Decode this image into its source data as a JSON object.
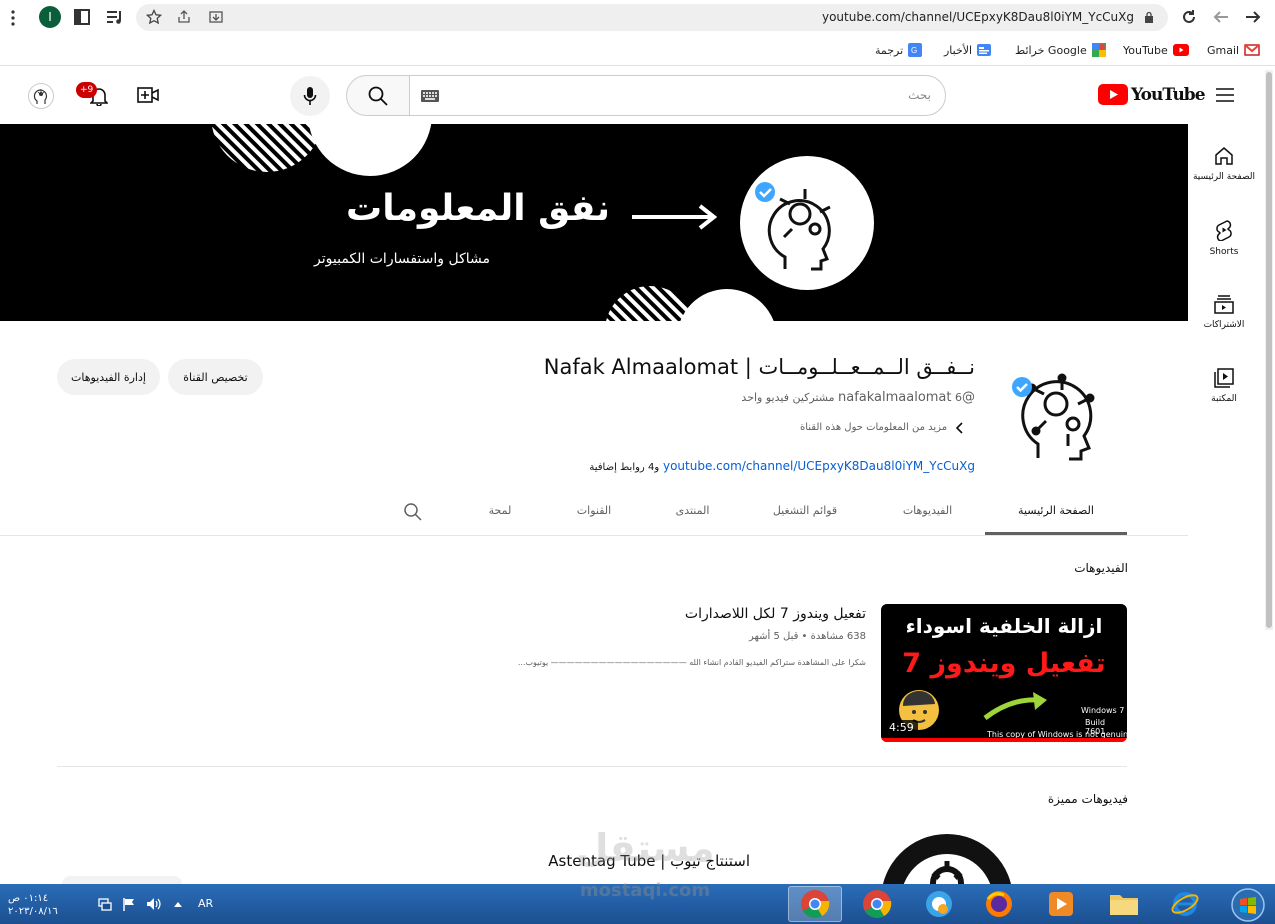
{
  "browser": {
    "url": "youtube.com/channel/UCEpxyK8Dau8l0iYM_YcCuXg",
    "profile_initial": "I",
    "bookmarks": [
      {
        "label": "Gmail",
        "icon": "gmail-icon"
      },
      {
        "label": "YouTube",
        "icon": "youtube-icon"
      },
      {
        "label": "خرائط Google",
        "icon": "maps-icon"
      },
      {
        "label": "الأخبار",
        "icon": "news-icon"
      },
      {
        "label": "ترجمة",
        "icon": "translate-icon"
      }
    ]
  },
  "header": {
    "logo_text": "YouTube",
    "search_placeholder": "بحث",
    "notifications_badge": "+9"
  },
  "guide": {
    "items": [
      {
        "label": "الصفحة الرئيسية",
        "icon": "home-icon"
      },
      {
        "label": "Shorts",
        "icon": "shorts-icon"
      },
      {
        "label": "الاشتراكات",
        "icon": "subscriptions-icon"
      },
      {
        "label": "المكتبة",
        "icon": "library-icon"
      }
    ]
  },
  "banner": {
    "title": "نفق المعلومات",
    "subtitle": "مشاكل واستفسارات الكمبيوتر"
  },
  "channel": {
    "name": "نــفــق الــمــعــلــومــات | Nafak Almaalomat",
    "handle": "@nafakalmaalomat",
    "stats": "6 مشتركين  فيديو واحد",
    "more_about": "مزيد من المعلومات حول هذه القناة",
    "link_url": "youtube.com/channel/UCEpxyK8Dau8l0iYM_YcCuXg",
    "link_suffix": "و4 روابط إضافية",
    "customize_button": "تخصيص القناة",
    "manage_videos_button": "إدارة الفيديوهات"
  },
  "tabs": [
    {
      "label": "الصفحة الرئيسية",
      "active": true
    },
    {
      "label": "الفيديوهات",
      "active": false
    },
    {
      "label": "قوائم التشغيل",
      "active": false
    },
    {
      "label": "المنتدى",
      "active": false
    },
    {
      "label": "القنوات",
      "active": false
    },
    {
      "label": "لمحة",
      "active": false
    }
  ],
  "videos_section": {
    "heading": "الفيديوهات",
    "video": {
      "title": "تفعيل ويندوز 7 لكل اللاصدارات",
      "meta": "638 مشاهدة • قبل 5 أشهر",
      "description": "شكرا على المشاهدة ستراكم الفيديو القادم انشاء الله ————————————————— يوتيوب...",
      "duration": "4:59",
      "thumb_line1": "ازالة الخلفية اسوداء",
      "thumb_line2": "تفعيل ويندوز 7",
      "thumb_win_line1": "Windows 7",
      "thumb_win_line2": "Build 7601",
      "thumb_win_line3": "This copy of Windows is not genuine"
    }
  },
  "featured_section": {
    "heading": "فيديوهات مميزة",
    "channel_title": "استنتاج تيوب | Astentag Tube"
  },
  "watermark": {
    "ar": "مستقل",
    "latin": "mostaqi.com"
  },
  "taskbar": {
    "time": "٠١:١٤ ص",
    "date": "٢٠٢٣/٠٨/١٦",
    "language": "AR"
  },
  "colors": {
    "youtube_red": "#ff0000",
    "link_blue": "#065fd4",
    "verified_blue": "#3ea6ff",
    "taskbar_blue": "#1c4f91"
  }
}
